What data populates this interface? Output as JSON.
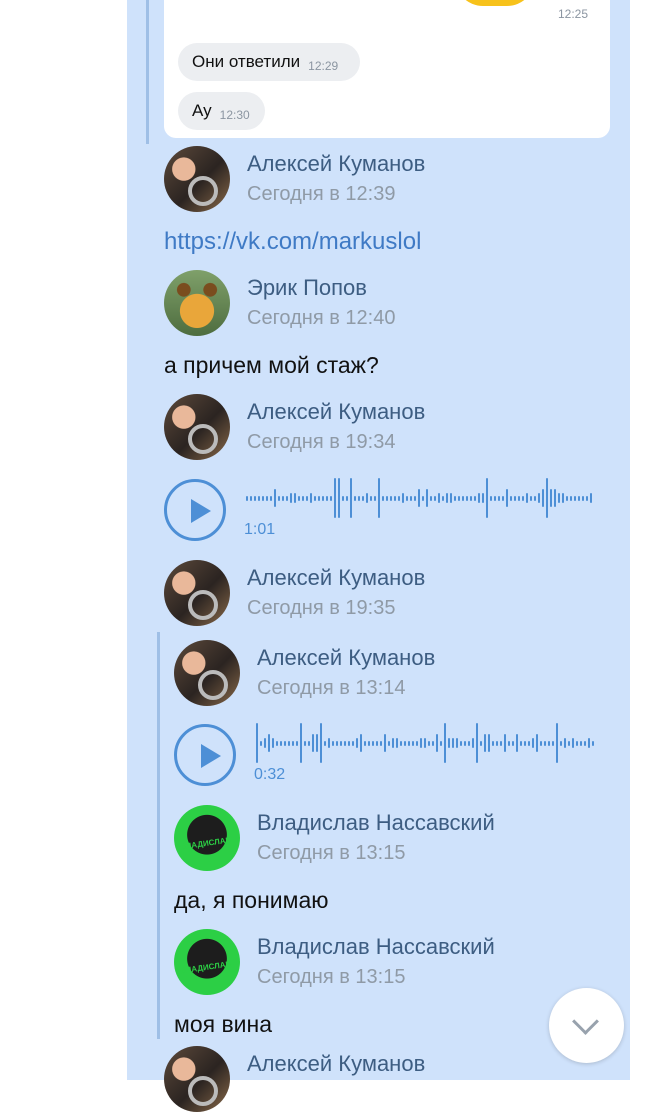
{
  "card": {
    "top_time": "12:25",
    "bubbles": [
      {
        "text": "Они ответили",
        "time": "12:29"
      },
      {
        "text": "Ау",
        "time": "12:30"
      }
    ]
  },
  "messages": [
    {
      "author": "Алексей Куманов",
      "date": "Сегодня в 12:39",
      "link": "https://vk.com/markuslol",
      "avatar": "avatar-photo-car"
    },
    {
      "author": "Эрик Попов",
      "date": "Сегодня в 12:40",
      "text": "а причем мой стаж?",
      "avatar": "avatar-bear"
    },
    {
      "author": "Алексей Куманов",
      "date": "Сегодня в 19:34",
      "voice_duration": "1:01",
      "avatar": "avatar-photo-car"
    },
    {
      "author": "Алексей Куманов",
      "date": "Сегодня в 19:35",
      "avatar": "avatar-photo-car"
    }
  ],
  "forwarded": [
    {
      "author": "Алексей Куманов",
      "date": "Сегодня в 13:14",
      "voice_duration": "0:32",
      "avatar": "avatar-photo-car"
    },
    {
      "author": "Владислав Нассавский",
      "date": "Сегодня в 13:15",
      "text": "да, я понимаю",
      "avatar": "avatar-green-logo"
    },
    {
      "author": "Владислав Нассавский",
      "date": "Сегодня в 13:15",
      "text": "моя вина",
      "avatar": "avatar-green-logo"
    }
  ],
  "bottom": {
    "author": "Алексей Куманов"
  },
  "icons": {
    "play": "play-icon",
    "scroll_down": "chevron-down-icon"
  },
  "colors": {
    "panel_bg": "#cfe2fb",
    "link": "#3f7ac5",
    "name": "#3d5d82",
    "voice": "#4d8fd6"
  }
}
